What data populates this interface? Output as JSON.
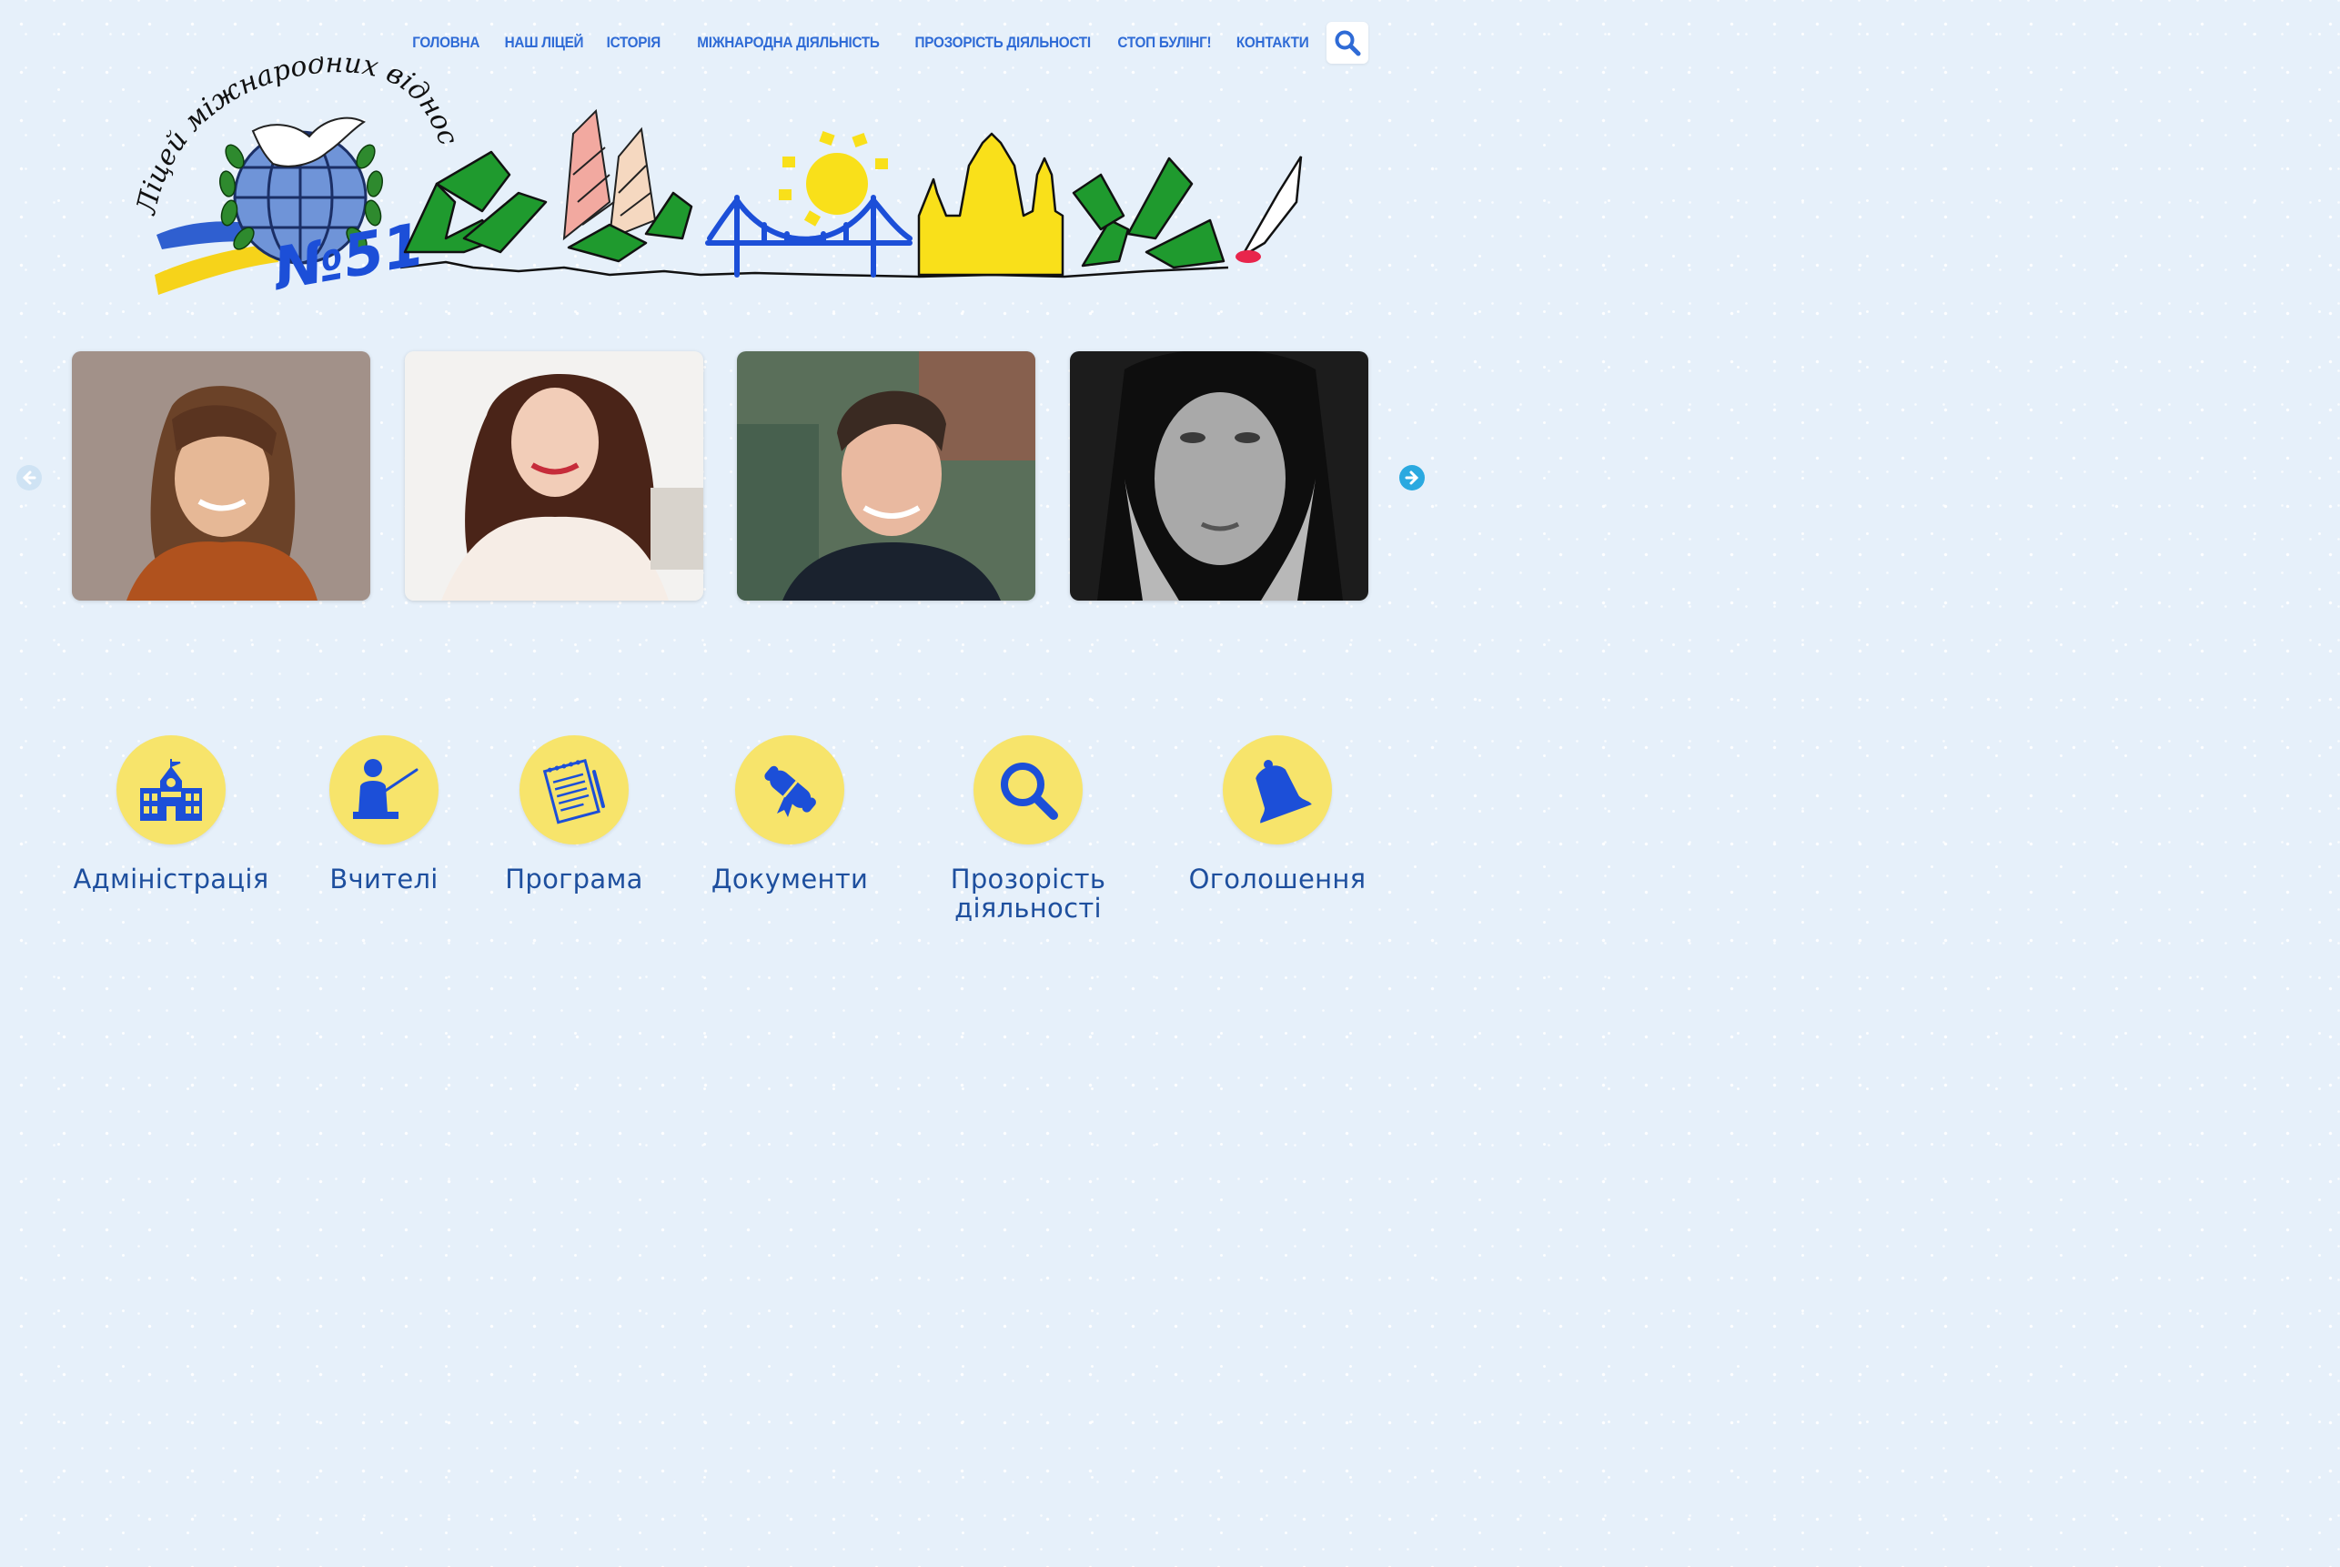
{
  "nav": {
    "items": [
      "ГОЛОВНА",
      "НАШ ЛІЦЕЙ",
      "ІСТОРІЯ",
      "МІЖНАРОДНА ДІЯЛЬНІСТЬ",
      "ПРОЗОРІСТЬ ДІЯЛЬНОСТІ",
      "СТОП БУЛІНГ!",
      "КОНТАКТИ"
    ],
    "search_icon": "search-icon"
  },
  "logo": {
    "script_text": "Ліцей міжнародних віднос",
    "number_text": "№51",
    "icon": "dove-globe-emblem"
  },
  "carousel": {
    "prev_icon": "arrow-left-icon",
    "next_icon": "arrow-right-icon",
    "slides": [
      "person-photo",
      "person-photo",
      "person-photo",
      "person-photo"
    ]
  },
  "categories": [
    {
      "label": "Адміністрація",
      "icon": "school-building-icon"
    },
    {
      "label": "Вчителі",
      "icon": "teacher-icon"
    },
    {
      "label": "Програма",
      "icon": "notepad-icon"
    },
    {
      "label": "Документи",
      "icon": "scroll-icon"
    },
    {
      "label": "Прозорість\nдіяльності",
      "icon": "magnifier-icon"
    },
    {
      "label": "Оголошення",
      "icon": "bell-icon"
    }
  ],
  "colors": {
    "nav_text": "#2f6bd6",
    "category_circle": "#f7e46b",
    "category_icon": "#1c4fd8",
    "category_label": "#1e4f9e",
    "background": "#e6f0fa"
  }
}
